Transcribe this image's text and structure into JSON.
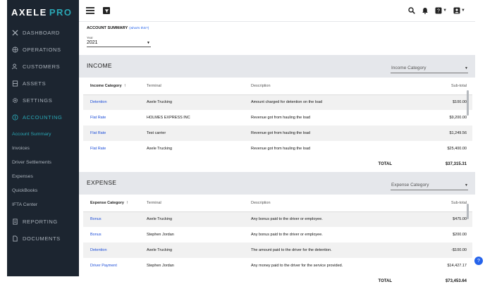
{
  "logo": {
    "main": "AXELE",
    "accent": "PRO"
  },
  "colors": {
    "sidebar_bg": "#1c2530",
    "accent": "#2aa6b4",
    "link": "#1d4ed8"
  },
  "sidebar": {
    "items": [
      {
        "label": "DASHBOARD",
        "icon": "x-icon"
      },
      {
        "label": "OPERATIONS",
        "icon": "globe-icon"
      },
      {
        "label": "CUSTOMERS",
        "icon": "people-icon"
      },
      {
        "label": "ASSETS",
        "icon": "truck-icon"
      },
      {
        "label": "SETTINGS",
        "icon": "gear-icon"
      },
      {
        "label": "ACCOUNTING",
        "icon": "money-icon"
      }
    ],
    "subitems": [
      {
        "label": "Account Summary"
      },
      {
        "label": "Invoices"
      },
      {
        "label": "Driver Settlements"
      },
      {
        "label": "Expenses"
      },
      {
        "label": "QuickBooks"
      },
      {
        "label": "IFTA Center"
      }
    ],
    "bottom_items": [
      {
        "label": "REPORTING",
        "icon": "report-icon"
      },
      {
        "label": "DOCUMENTS",
        "icon": "document-icon"
      }
    ]
  },
  "topbar": {
    "help_badge": "?"
  },
  "summary": {
    "title": "ACCOUNT SUMMARY",
    "whats_this": "(what's this?)",
    "year_label": "Year",
    "year_value": "2021"
  },
  "income": {
    "title": "INCOME",
    "category_placeholder": "Income Category",
    "headers": {
      "category": "Income Category",
      "terminal": "Terminal",
      "description": "Description",
      "subtotal": "Sub-total"
    },
    "rows": [
      {
        "category": "Detention",
        "terminal": "Axele Trucking",
        "description": "Amount charged for detention on the load",
        "subtotal": "$100.00"
      },
      {
        "category": "Flat Rate",
        "terminal": "HOLMES EXPRESS INC",
        "description": "Revenue got from hauling the load",
        "subtotal": "$9,200.00"
      },
      {
        "category": "Flat Rate",
        "terminal": "Test carrier",
        "description": "Revenue got from hauling the load",
        "subtotal": "$1,249.56"
      },
      {
        "category": "Flat Rate",
        "terminal": "Axele Trucking",
        "description": "Revenue got from hauling the load",
        "subtotal": "$25,400.00"
      }
    ],
    "total_label": "TOTAL",
    "total_value": "$37,315.31"
  },
  "expense": {
    "title": "EXPENSE",
    "category_placeholder": "Expense Category",
    "headers": {
      "category": "Expense Category",
      "terminal": "Terminal",
      "description": "Description",
      "subtotal": "Sub-total"
    },
    "rows": [
      {
        "category": "Bonus",
        "terminal": "Axele Trucking",
        "description": "Any bonus paid to the driver or employee.",
        "subtotal": "$475.00"
      },
      {
        "category": "Bonus",
        "terminal": "Stephen Jordan",
        "description": "Any bonus paid to the driver or employee.",
        "subtotal": "$200.00"
      },
      {
        "category": "Detention",
        "terminal": "Axele Trucking",
        "description": "The amount paid to the driver for the detention.",
        "subtotal": "-$100.00"
      },
      {
        "category": "Driver Payment",
        "terminal": "Stephen Jordan",
        "description": "Any money paid to the driver for the service provided.",
        "subtotal": "$14,427.17"
      }
    ],
    "total_label": "TOTAL",
    "total_value": "$73,453.64"
  }
}
